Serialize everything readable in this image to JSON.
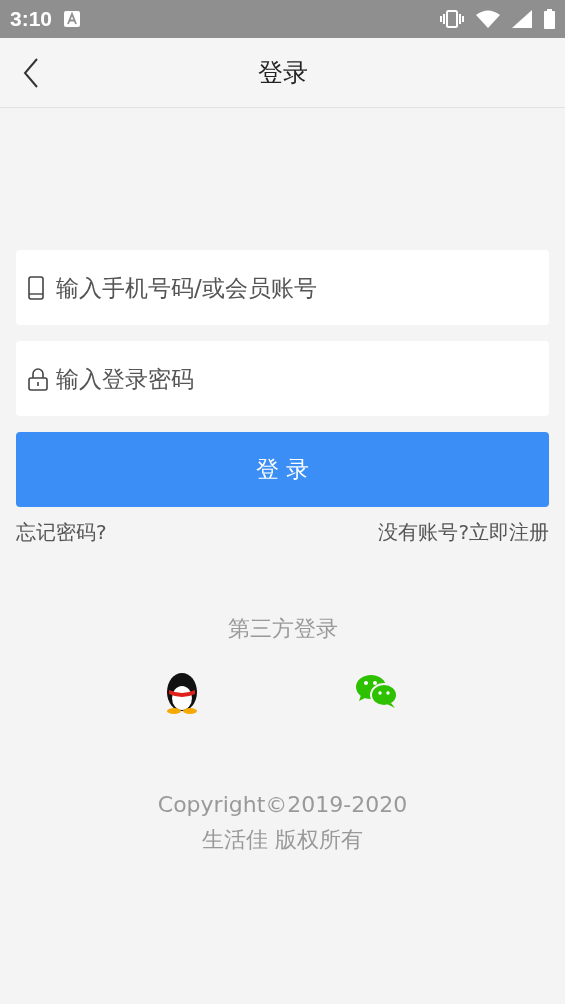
{
  "status_bar": {
    "time": "3:10"
  },
  "header": {
    "title": "登录"
  },
  "fields": [
    {
      "kind": "phone",
      "placeholder": "输入手机号码/或会员账号"
    },
    {
      "kind": "password",
      "placeholder": "输入登录密码"
    }
  ],
  "login_button": {
    "label": "登 录"
  },
  "links": {
    "forgot": "忘记密码?",
    "register": "没有账号?立即注册"
  },
  "third_party": {
    "title": "第三方登录",
    "providers": [
      {
        "kind": "qq"
      },
      {
        "kind": "wechat"
      }
    ]
  },
  "footer": {
    "lines": [
      "Copyright©2019-2020",
      "生活佳 版权所有"
    ]
  }
}
